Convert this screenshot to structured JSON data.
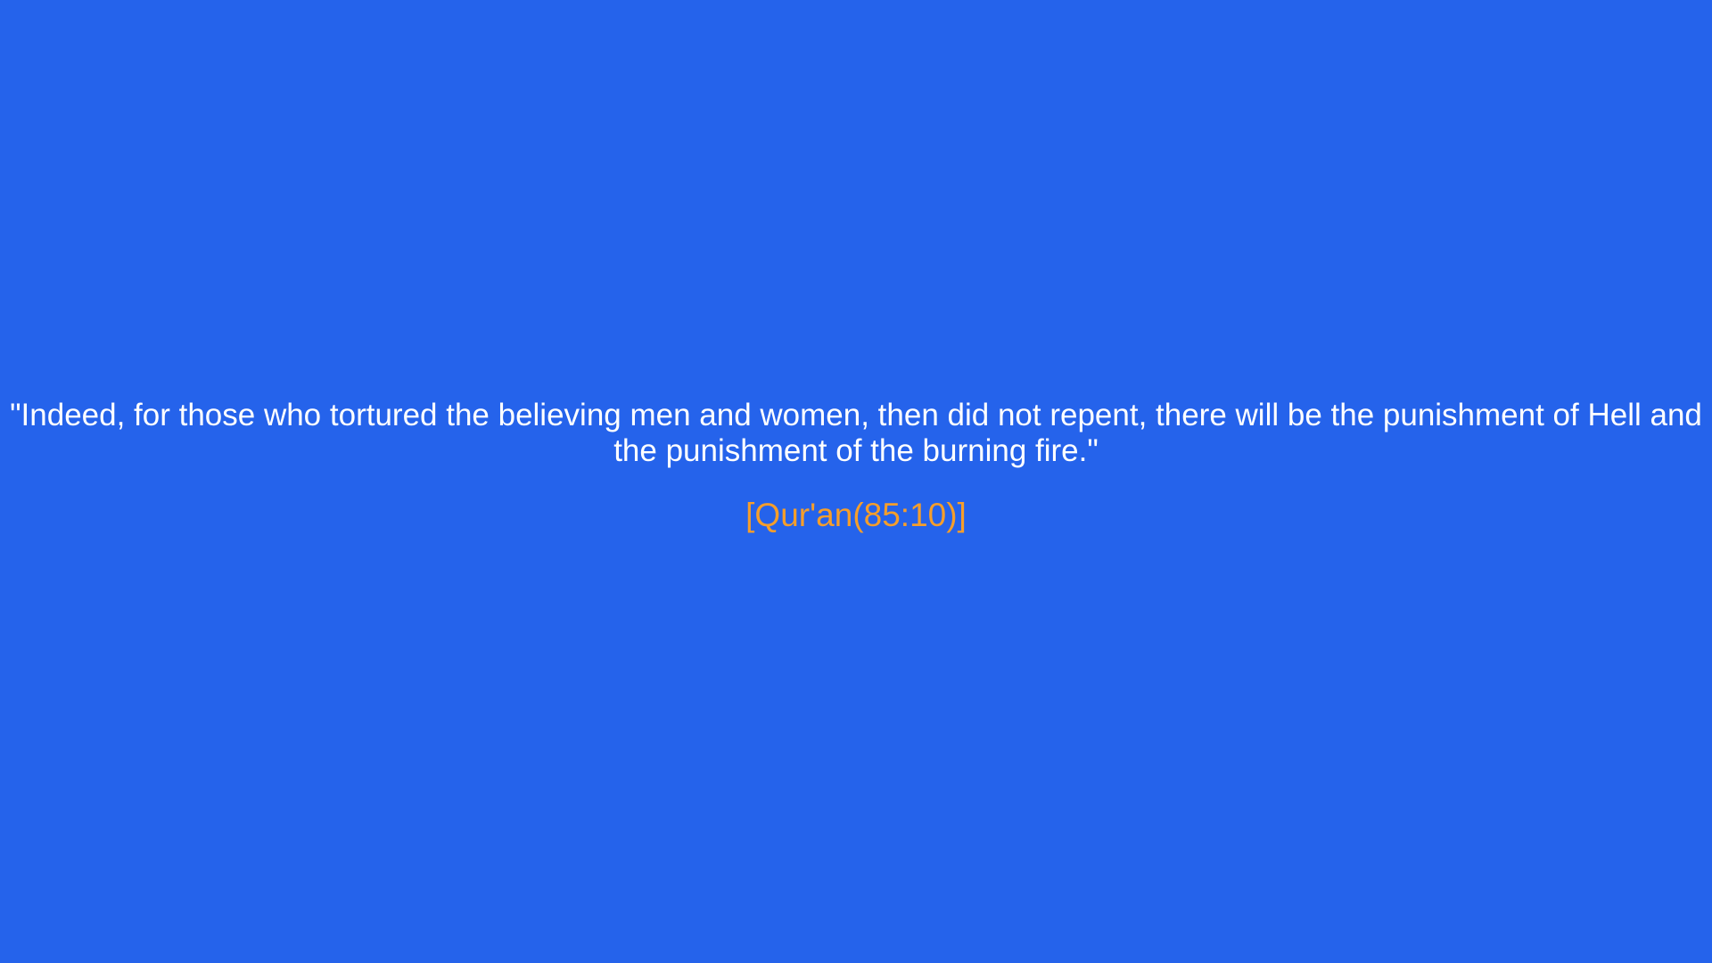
{
  "quote": {
    "text": "\"Indeed, for those who tortured the believing men and women, then did not repent, there will be the punishment of Hell and the punishment of the burning fire.\"",
    "source": "[Qur'an(85:10)]"
  },
  "colors": {
    "background": "#2563EB",
    "quote_text": "#FFFFFF",
    "source_text": "#F59E2B"
  }
}
